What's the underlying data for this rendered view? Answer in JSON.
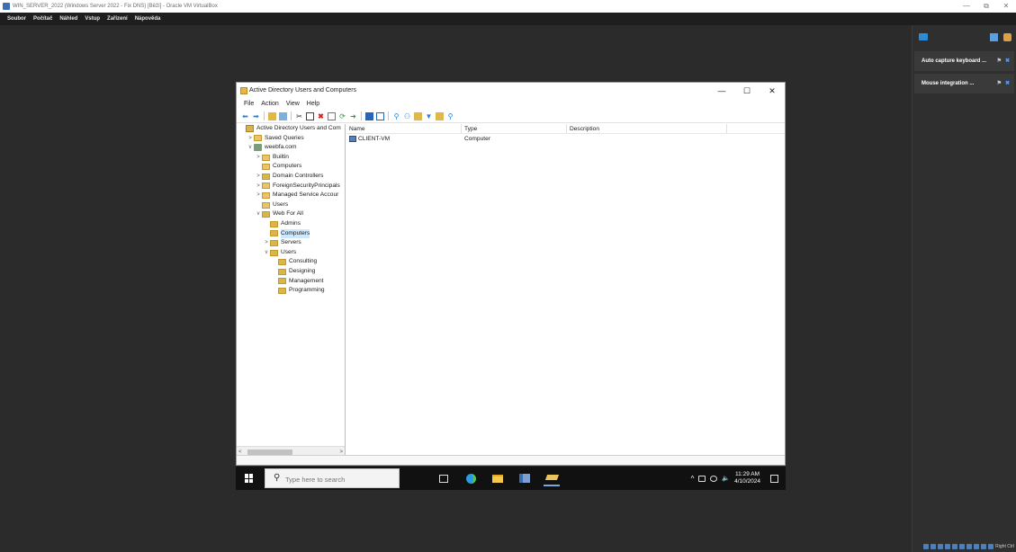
{
  "host": {
    "title": "WIN_SERVER_2022 (Windows Server 2022 - Fix DNS) [Běží] - Oracle VM VirtualBox",
    "menu": [
      "Soubor",
      "Počítač",
      "Náhled",
      "Vstup",
      "Zařízení",
      "Nápověda"
    ],
    "win_controls": [
      "—",
      "⧉",
      "✕"
    ]
  },
  "notifications": [
    {
      "label": "Auto capture keyboard ..."
    },
    {
      "label": "Mouse integration ..."
    }
  ],
  "statusbar": {
    "right_ctrl": "Right Ctrl"
  },
  "aduc": {
    "title": "Active Directory Users and Computers",
    "controls": [
      "—",
      "☐",
      "✕"
    ],
    "menu": [
      "File",
      "Action",
      "View",
      "Help"
    ],
    "tree": [
      {
        "label": "Active Directory Users and Com",
        "exp": "",
        "level": 0,
        "icon": "root"
      },
      {
        "label": "Saved Queries",
        "exp": ">",
        "level": 1,
        "icon": "folder"
      },
      {
        "label": "weebfa.com",
        "exp": "v",
        "level": 1,
        "icon": "domain"
      },
      {
        "label": "Builtin",
        "exp": ">",
        "level": 2,
        "icon": "folder"
      },
      {
        "label": "Computers",
        "exp": "",
        "level": 2,
        "icon": "folder"
      },
      {
        "label": "Domain Controllers",
        "exp": ">",
        "level": 2,
        "icon": "ou"
      },
      {
        "label": "ForeignSecurityPrincipals",
        "exp": ">",
        "level": 2,
        "icon": "folder"
      },
      {
        "label": "Managed Service Accour",
        "exp": ">",
        "level": 2,
        "icon": "folder"
      },
      {
        "label": "Users",
        "exp": "",
        "level": 2,
        "icon": "folder"
      },
      {
        "label": "Web For All",
        "exp": "v",
        "level": 2,
        "icon": "ou"
      },
      {
        "label": "Admins",
        "exp": "",
        "level": 3,
        "icon": "ou"
      },
      {
        "label": "Computers",
        "exp": "",
        "level": 3,
        "icon": "ou",
        "selected": true
      },
      {
        "label": "Servers",
        "exp": ">",
        "level": 3,
        "icon": "ou"
      },
      {
        "label": "Users",
        "exp": "v",
        "level": 3,
        "icon": "ou"
      },
      {
        "label": "Consulting",
        "exp": "",
        "level": 4,
        "icon": "ou"
      },
      {
        "label": "Designing",
        "exp": "",
        "level": 4,
        "icon": "ou"
      },
      {
        "label": "Management",
        "exp": "",
        "level": 4,
        "icon": "ou"
      },
      {
        "label": "Programming",
        "exp": "",
        "level": 4,
        "icon": "ou"
      }
    ],
    "columns": [
      "Name",
      "Type",
      "Description"
    ],
    "rows": [
      {
        "name": "CLIENT-VM",
        "type": "Computer",
        "description": ""
      }
    ]
  },
  "taskbar": {
    "search_placeholder": "Type here to search",
    "time": "11:29 AM",
    "date": "4/10/2024"
  }
}
